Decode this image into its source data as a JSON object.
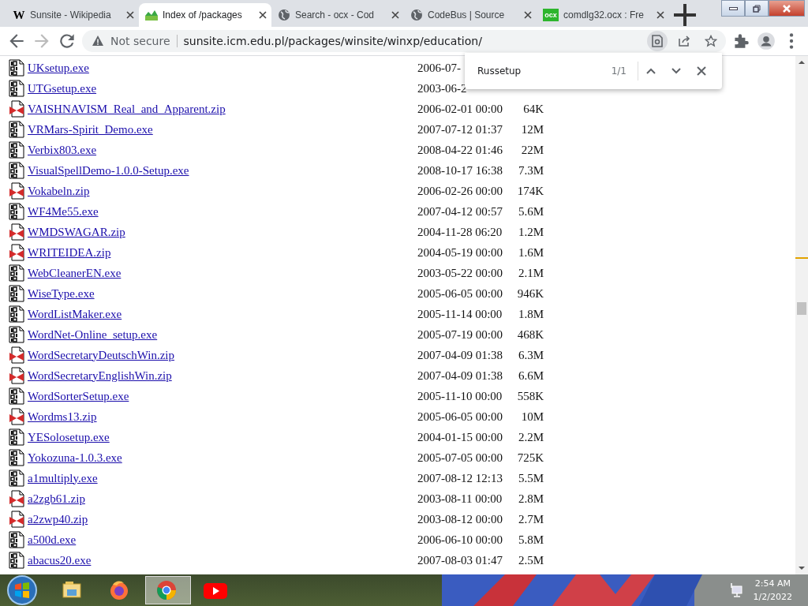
{
  "tabs": [
    {
      "title": "Sunsite - Wikipedia",
      "kind": "letter",
      "favicon_text": "W",
      "selected": false
    },
    {
      "title": "Index of /packages",
      "kind": "sunsite",
      "selected": true
    },
    {
      "title": "Search - ocx - Cod",
      "kind": "globe",
      "selected": false
    },
    {
      "title": "CodeBus | Source",
      "kind": "globe",
      "selected": false
    },
    {
      "title": "comdlg32.ocx : Fre",
      "kind": "badge",
      "favicon_text": "ocx",
      "selected": false
    }
  ],
  "address_bar": {
    "security": "Not secure",
    "url": "sunsite.icm.edu.pl/packages/winsite/winxp/education/"
  },
  "find_bar": {
    "query": "Russetup",
    "count": "1/1"
  },
  "listing": [
    {
      "name": "UKsetup.exe",
      "kind": "exe",
      "date": "2006-07-"
    },
    {
      "name": "UTGsetup.exe",
      "kind": "exe",
      "date": "2003-06-2"
    },
    {
      "name": "VAISHNAVISM_Real_and_Apparent.zip",
      "kind": "zip",
      "date": "2006-02-01 00:00",
      "size": "64K"
    },
    {
      "name": "VRMars-Spirit_Demo.exe",
      "kind": "exe",
      "date": "2007-07-12 01:37",
      "size": "12M"
    },
    {
      "name": "Verbix803.exe",
      "kind": "exe",
      "date": "2008-04-22 01:46",
      "size": "22M"
    },
    {
      "name": "VisualSpellDemo-1.0.0-Setup.exe",
      "kind": "exe",
      "date": "2008-10-17 16:38",
      "size": "7.3M"
    },
    {
      "name": "Vokabeln.zip",
      "kind": "zip",
      "date": "2006-02-26 00:00",
      "size": "174K"
    },
    {
      "name": "WF4Me55.exe",
      "kind": "exe",
      "date": "2007-04-12 00:57",
      "size": "5.6M"
    },
    {
      "name": "WMDSWAGAR.zip",
      "kind": "zip",
      "date": "2004-11-28 06:20",
      "size": "1.2M"
    },
    {
      "name": "WRITEIDEA.zip",
      "kind": "zip",
      "date": "2004-05-19 00:00",
      "size": "1.6M"
    },
    {
      "name": "WebCleanerEN.exe",
      "kind": "exe",
      "date": "2003-05-22 00:00",
      "size": "2.1M"
    },
    {
      "name": "WiseType.exe",
      "kind": "exe",
      "date": "2005-06-05 00:00",
      "size": "946K"
    },
    {
      "name": "WordListMaker.exe",
      "kind": "exe",
      "date": "2005-11-14 00:00",
      "size": "1.8M"
    },
    {
      "name": "WordNet-Online_setup.exe",
      "kind": "exe",
      "date": "2005-07-19 00:00",
      "size": "468K"
    },
    {
      "name": "WordSecretaryDeutschWin.zip",
      "kind": "zip",
      "date": "2007-04-09 01:38",
      "size": "6.3M"
    },
    {
      "name": "WordSecretaryEnglishWin.zip",
      "kind": "zip",
      "date": "2007-04-09 01:38",
      "size": "6.6M"
    },
    {
      "name": "WordSorterSetup.exe",
      "kind": "exe",
      "date": "2005-11-10 00:00",
      "size": "558K"
    },
    {
      "name": "Wordms13.zip",
      "kind": "zip",
      "date": "2005-06-05 00:00",
      "size": "10M"
    },
    {
      "name": "YESolosetup.exe",
      "kind": "exe",
      "date": "2004-01-15 00:00",
      "size": "2.2M"
    },
    {
      "name": "Yokozuna-1.0.3.exe",
      "kind": "exe",
      "date": "2005-07-05 00:00",
      "size": "725K"
    },
    {
      "name": "a1multiply.exe",
      "kind": "exe",
      "date": "2007-08-12 12:13",
      "size": "5.5M"
    },
    {
      "name": "a2zgb61.zip",
      "kind": "zip",
      "date": "2003-08-11 00:00",
      "size": "2.8M"
    },
    {
      "name": "a2zwp40.zip",
      "kind": "zip",
      "date": "2003-08-12 00:00",
      "size": "2.7M"
    },
    {
      "name": "a500d.exe",
      "kind": "exe",
      "date": "2006-06-10 00:00",
      "size": "5.8M"
    },
    {
      "name": "abacus20.exe",
      "kind": "exe",
      "date": "2007-08-03 01:47",
      "size": "2.5M"
    }
  ],
  "taskbar": {
    "apps": [
      {
        "kind": "explorer",
        "selected": false
      },
      {
        "kind": "firefox",
        "selected": false
      },
      {
        "kind": "chrome",
        "selected": true
      },
      {
        "kind": "youtube",
        "selected": false
      }
    ],
    "time": "2:54 AM",
    "date": "1/2/2022"
  }
}
